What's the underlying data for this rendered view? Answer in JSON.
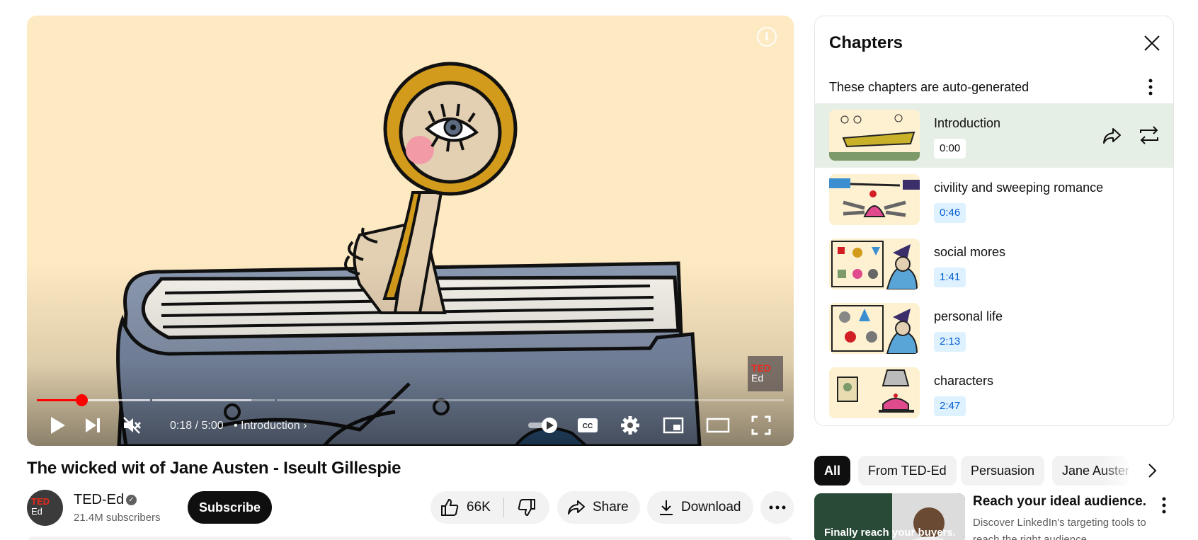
{
  "player": {
    "time_current": "0:18",
    "time_total": "5:00",
    "time_display": "0:18 / 5:00",
    "chapter_label": "Introduction",
    "progress_fraction": 0.06,
    "watermark_top": "TED",
    "watermark_bottom": "Ed"
  },
  "video": {
    "title": "The wicked wit of Jane Austen - Iseult Gillespie"
  },
  "channel": {
    "avatar_top": "TED",
    "avatar_bottom": "Ed",
    "name": "TED-Ed",
    "subscribers": "21.4M subscribers",
    "subscribe_label": "Subscribe"
  },
  "actions": {
    "likes": "66K",
    "share_label": "Share",
    "download_label": "Download"
  },
  "chapters_panel": {
    "title": "Chapters",
    "subtitle": "These chapters are auto-generated",
    "items": [
      {
        "title": "Introduction",
        "time": "0:00",
        "active": true
      },
      {
        "title": "civility and sweeping romance",
        "time": "0:46",
        "active": false
      },
      {
        "title": "social mores",
        "time": "1:41",
        "active": false
      },
      {
        "title": "personal life",
        "time": "2:13",
        "active": false
      },
      {
        "title": "characters",
        "time": "2:47",
        "active": false
      }
    ]
  },
  "chips": [
    "All",
    "From TED-Ed",
    "Persuasion",
    "Jane Austen"
  ],
  "ad": {
    "thumb_text": "Finally reach your buyers.",
    "title": "Reach your ideal audience.",
    "description": "Discover LinkedIn's targeting tools to reach the right audience."
  },
  "colors": {
    "accent_red": "#ff0000",
    "chapter_time_blue": "#065fd4",
    "active_chapter_bg": "#e6efe6"
  }
}
